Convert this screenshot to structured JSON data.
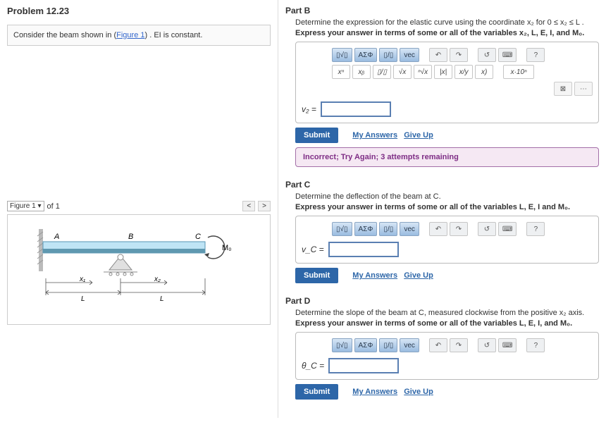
{
  "problem": {
    "title": "Problem 12.23",
    "statement_pre": "Consider the beam shown in (",
    "statement_link": "Figure 1",
    "statement_post": ") . EI is constant."
  },
  "figure": {
    "label": "Figure 1",
    "count_text": "of 1",
    "nav_prev": "<",
    "nav_next": ">",
    "labels": {
      "A": "A",
      "B": "B",
      "C": "C",
      "M0": "M₀",
      "x1": "x₁",
      "x2": "x₂",
      "L1": "L",
      "L2": "L"
    }
  },
  "toolbar": {
    "templates_icon": "▯√▯",
    "greek": "ΑΣΦ",
    "frac_icon": "▯/▯",
    "vec": "vec",
    "undo": "↶",
    "redo": "↷",
    "reset": "↺",
    "keyboard": "⌨",
    "help": "?",
    "xn": "xⁿ",
    "xb": "xᵦ",
    "frac": "▯/▯",
    "sqrt": "√x",
    "nroot": "ⁿ√x",
    "abs": "|x|",
    "xfrac": "x/y",
    "xparen": "x)",
    "sci": "x·10ⁿ",
    "close": "⊠",
    "dots": "⋯"
  },
  "partB": {
    "title": "Part B",
    "prompt": "Determine the expression for the elastic curve using the coordinate x₂ for 0 ≤ x₂ ≤ L .",
    "instruct": "Express your answer in terms of some or all of the variables x₂, L, E, I, and M₀.",
    "var": "v₂ =",
    "value": "",
    "submit": "Submit",
    "myanswers": "My Answers",
    "giveup": "Give Up",
    "feedback": "Incorrect; Try Again; 3 attempts remaining"
  },
  "partC": {
    "title": "Part C",
    "prompt": "Determine the deflection of the beam at C.",
    "instruct": "Express your answer in terms of some or all of the variables L, E, I and M₀.",
    "var": "v_C =",
    "value": "",
    "submit": "Submit",
    "myanswers": "My Answers",
    "giveup": "Give Up"
  },
  "partD": {
    "title": "Part D",
    "prompt": "Determine the slope of the beam at C, measured clockwise from the positive x₂ axis.",
    "instruct": "Express your answer in terms of some or all of the variables L, E, I, and M₀.",
    "var": "θ_C =",
    "value": "",
    "submit": "Submit",
    "myanswers": "My Answers",
    "giveup": "Give Up"
  }
}
